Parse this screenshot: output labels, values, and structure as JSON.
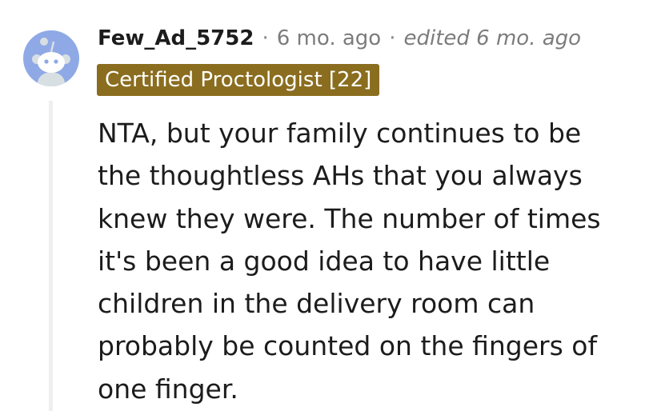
{
  "comment": {
    "avatar_icon": "snoo-avatar-icon",
    "author": "Few_Ad_5752",
    "separator": "·",
    "time": "6 mo. ago",
    "edited": "edited 6 mo. ago",
    "flair": "Certified Proctologist [22]",
    "body": "NTA, but your family continues to be the thoughtless AHs that you always knew they were. The number of times it's been a good idea to have little children in the delivery room can probably be counted on the fingers of one finger."
  },
  "colors": {
    "avatar_bg": "#8fa9e6",
    "flair_bg": "#8a6d1f",
    "flair_text": "#ffffff",
    "thread_line": "#edeff1"
  }
}
